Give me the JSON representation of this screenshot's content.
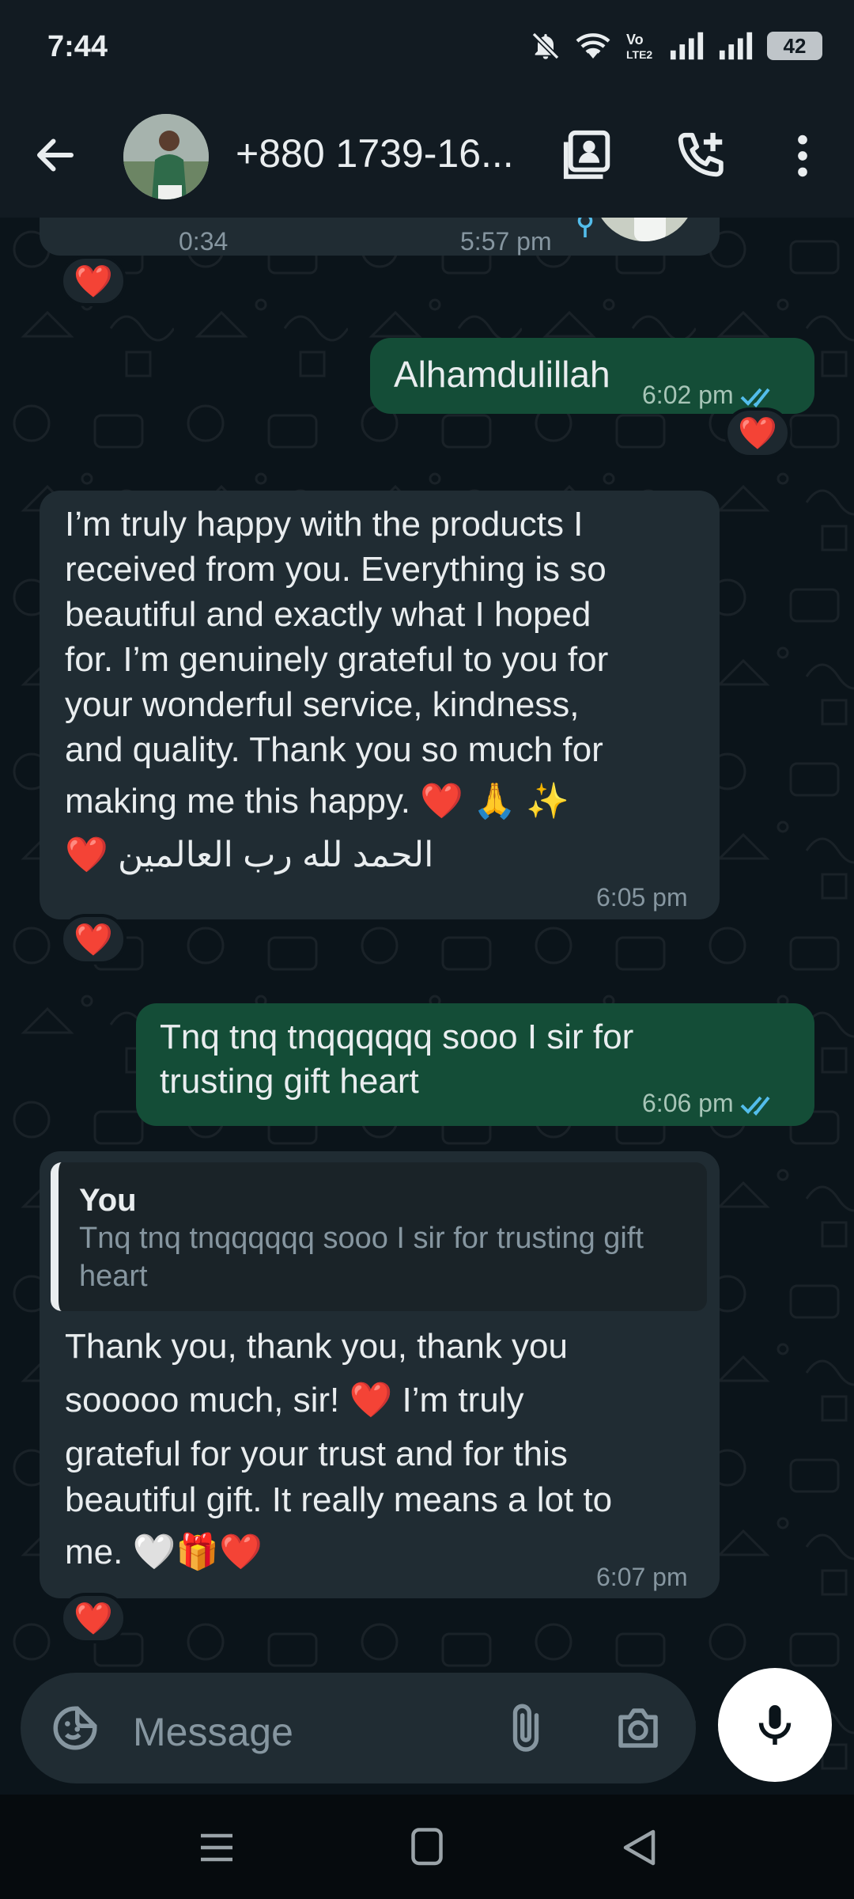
{
  "status_bar": {
    "time": "7:44",
    "battery": "42",
    "icons": [
      "mute-icon",
      "wifi-icon",
      "volte-icon",
      "signal-icon",
      "signal-icon",
      "battery-icon"
    ]
  },
  "header": {
    "contact_name": "+880 1739-16...",
    "icons": [
      "back-arrow-icon",
      "contact-card-icon",
      "add-call-icon",
      "more-vert-icon"
    ]
  },
  "messages": [
    {
      "direction": "in",
      "type": "video",
      "duration": "0:34",
      "time": "5:57 pm",
      "reaction": "❤️"
    },
    {
      "direction": "out",
      "text": "Alhamdulillah",
      "time": "6:02 pm",
      "status": "read",
      "reaction": "❤️"
    },
    {
      "direction": "in",
      "lines": [
        "I’m truly happy with the products I",
        "received from you. Everything is so",
        "beautiful and exactly what I hoped",
        "for. I’m genuinely grateful to you for",
        "your wonderful service, kindness,",
        "and quality. Thank you so much for",
        "making me this happy. ❤️ 🙏 ✨",
        "الحمد لله رب العالمين ❤️"
      ],
      "time": "6:05 pm",
      "reaction": "❤️"
    },
    {
      "direction": "out",
      "lines": [
        "Tnq tnq tnqqqqqq sooo I sir for",
        "trusting gift heart"
      ],
      "time": "6:06 pm",
      "status": "read"
    },
    {
      "direction": "in",
      "quote": {
        "author": "You",
        "text": "Tnq tnq tnqqqqqq sooo I sir for trusting gift heart"
      },
      "lines": [
        "Thank you, thank you, thank you",
        "sooooo much, sir! ❤️ I’m truly",
        "grateful for your trust and for this",
        "beautiful gift. It really means a lot to",
        "me. 🤍🎁❤️"
      ],
      "time": "6:07 pm",
      "reaction": "❤️"
    }
  ],
  "composer": {
    "placeholder": "Message",
    "icons": [
      "emoji-sticker-icon",
      "attach-icon",
      "camera-icon",
      "mic-icon"
    ]
  },
  "nav": {
    "icons": [
      "recents-icon",
      "home-icon",
      "back-icon"
    ]
  },
  "colors": {
    "background": "#0b141a",
    "bar": "#121b22",
    "incoming_bubble": "#202c33",
    "outgoing_bubble": "#144d37",
    "read_ticks": "#53bdeb",
    "secondary_text": "#8696a0"
  }
}
